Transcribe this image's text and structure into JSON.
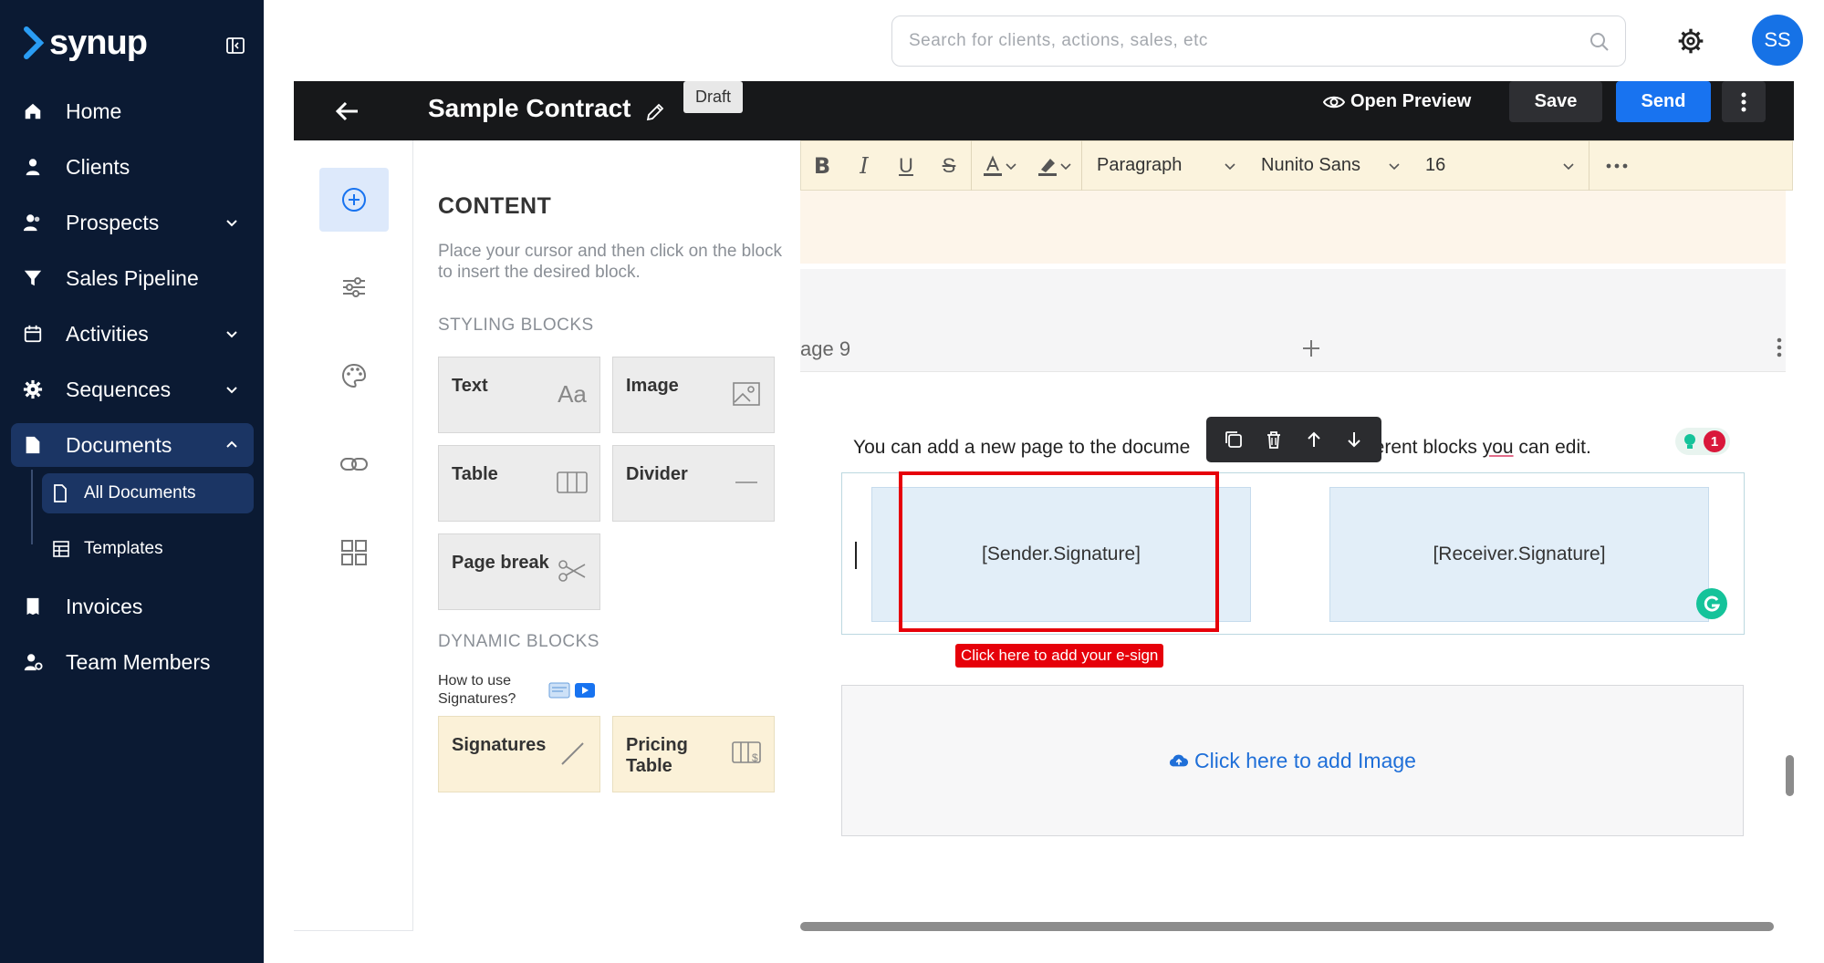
{
  "app": {
    "logo_text": "synup",
    "brand_color": "#1672e6"
  },
  "sidebar": {
    "items": [
      {
        "label": "Home",
        "icon": "home-icon"
      },
      {
        "label": "Clients",
        "icon": "user-icon"
      },
      {
        "label": "Prospects",
        "icon": "users-icon",
        "has_chevron": true
      },
      {
        "label": "Sales Pipeline",
        "icon": "funnel-icon"
      },
      {
        "label": "Activities",
        "icon": "calendar-icon",
        "has_chevron": true
      },
      {
        "label": "Sequences",
        "icon": "gear-icon",
        "has_chevron": true
      },
      {
        "label": "Documents",
        "icon": "document-icon",
        "has_chevron": true,
        "expanded": true
      },
      {
        "label": "Invoices",
        "icon": "invoice-icon"
      },
      {
        "label": "Team Members",
        "icon": "team-icon"
      }
    ],
    "documents_sub": [
      {
        "label": "All Documents",
        "active": true
      },
      {
        "label": "Templates"
      }
    ]
  },
  "header": {
    "search_placeholder": "Search for clients, actions, sales, etc",
    "avatar_initials": "SS"
  },
  "doc": {
    "title": "Sample Contract",
    "status": "Draft",
    "open_preview": "Open Preview",
    "save": "Save",
    "send": "Send"
  },
  "content_panel": {
    "title": "CONTENT",
    "description": "Place your cursor and then click on the block to insert the desired block.",
    "styling_heading": "STYLING BLOCKS",
    "styling_blocks": [
      "Text",
      "Image",
      "Table",
      "Divider",
      "Page break"
    ],
    "text_block_glyph": "Aa",
    "dynamic_heading": "DYNAMIC BLOCKS",
    "howto_line1": "How to use",
    "howto_line2": "Signatures?",
    "dynamic_blocks": [
      "Signatures",
      "Pricing",
      "Table"
    ]
  },
  "toolbar": {
    "paragraph": "Paragraph",
    "font": "Nunito Sans",
    "size": "16"
  },
  "editor": {
    "page_label": "age 9",
    "paragraph_start": "You can add a new page to the docume",
    "paragraph_mid": "fferent blocks ",
    "paragraph_you": "you",
    "paragraph_end": " can edit.",
    "sender_signature": "[Sender.Signature]",
    "receiver_signature": "[Receiver.Signature]",
    "esign_tip": "Click here to add your e-sign",
    "add_image": "Click here to add Image",
    "grammarly_count": "1"
  }
}
